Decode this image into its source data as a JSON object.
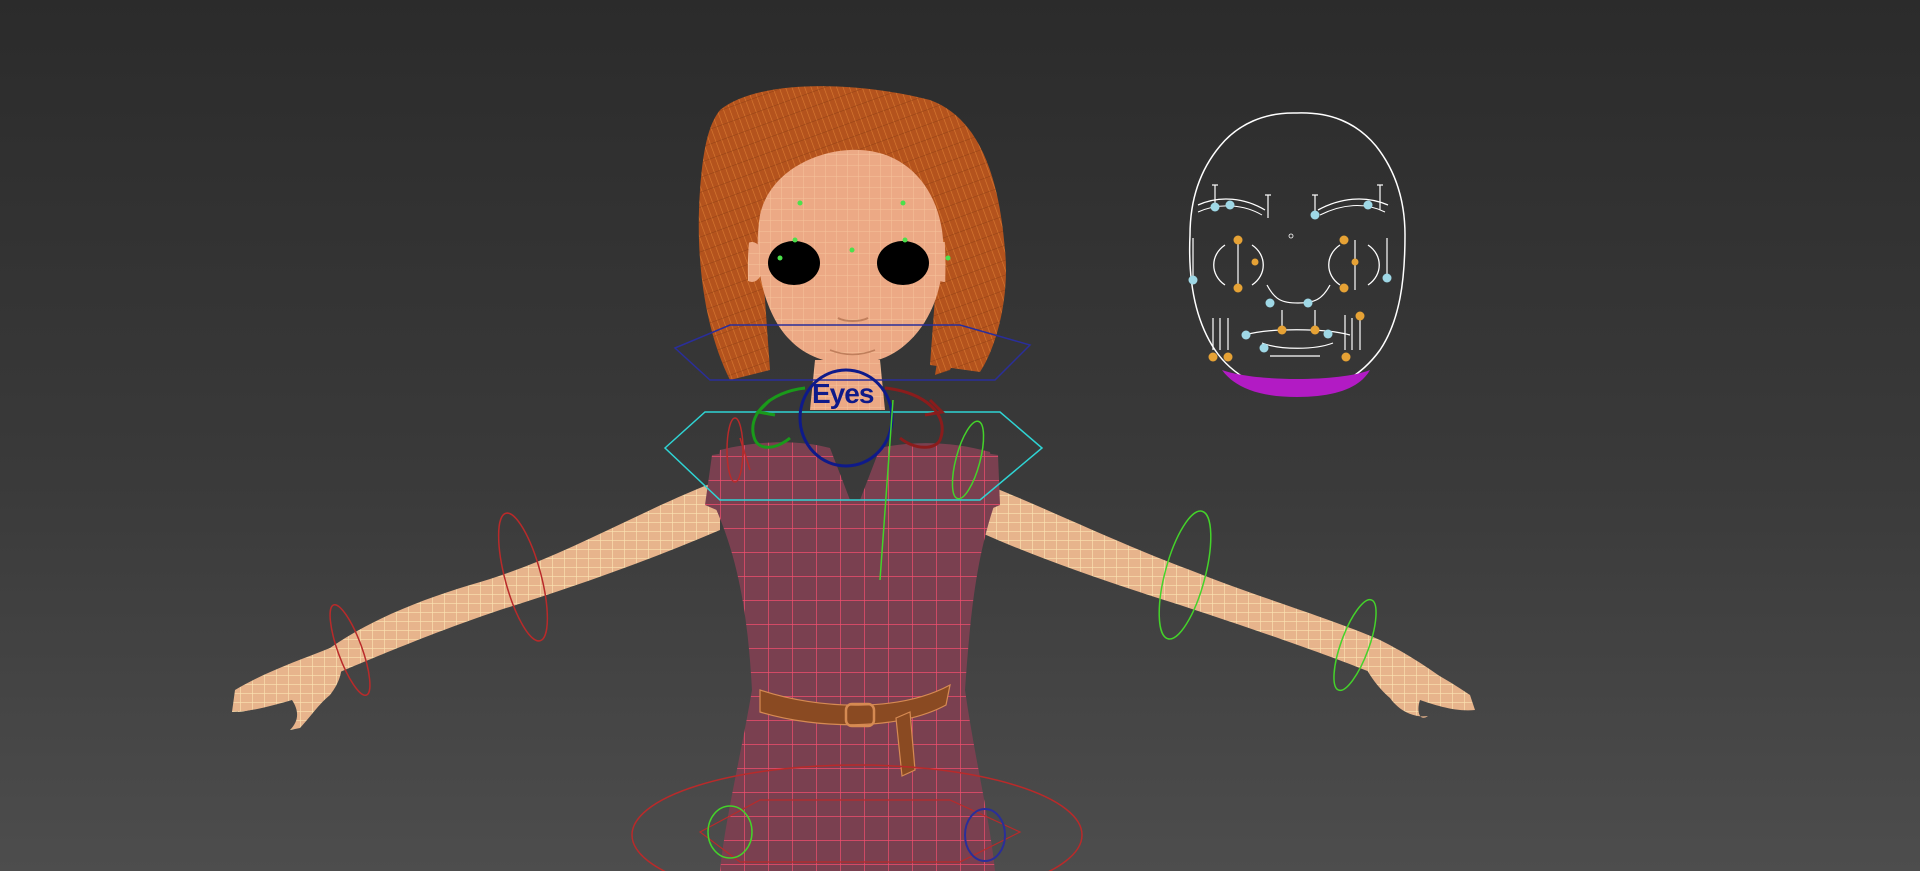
{
  "viewport": {
    "background_top": "#2b2b2b",
    "background_bottom": "#4d4d4d"
  },
  "character": {
    "skin_color": "#e9a980",
    "wire_skin_color": "#f6d6a4",
    "hair_color": "#b4531d",
    "dress_color": "#7a4050",
    "dress_wire_color": "#f04e6e",
    "belt_color": "#8a4a22"
  },
  "controls": {
    "eyes_label": "Eyes",
    "eyes_color": "#0e1a8a",
    "left_color": "#1a9a1a",
    "right_color": "#8a1c1c",
    "shoulder_color": "#2fd4d4",
    "neck_color": "#2a2e9a",
    "left_arm_color": "#44d32a",
    "right_arm_color": "#b92a2a"
  },
  "face_gui": {
    "outline_color": "#ffffff",
    "handle_color": "#9fd8e6",
    "joint_color": "#e6a235",
    "jaw_color": "#b21bc4"
  }
}
